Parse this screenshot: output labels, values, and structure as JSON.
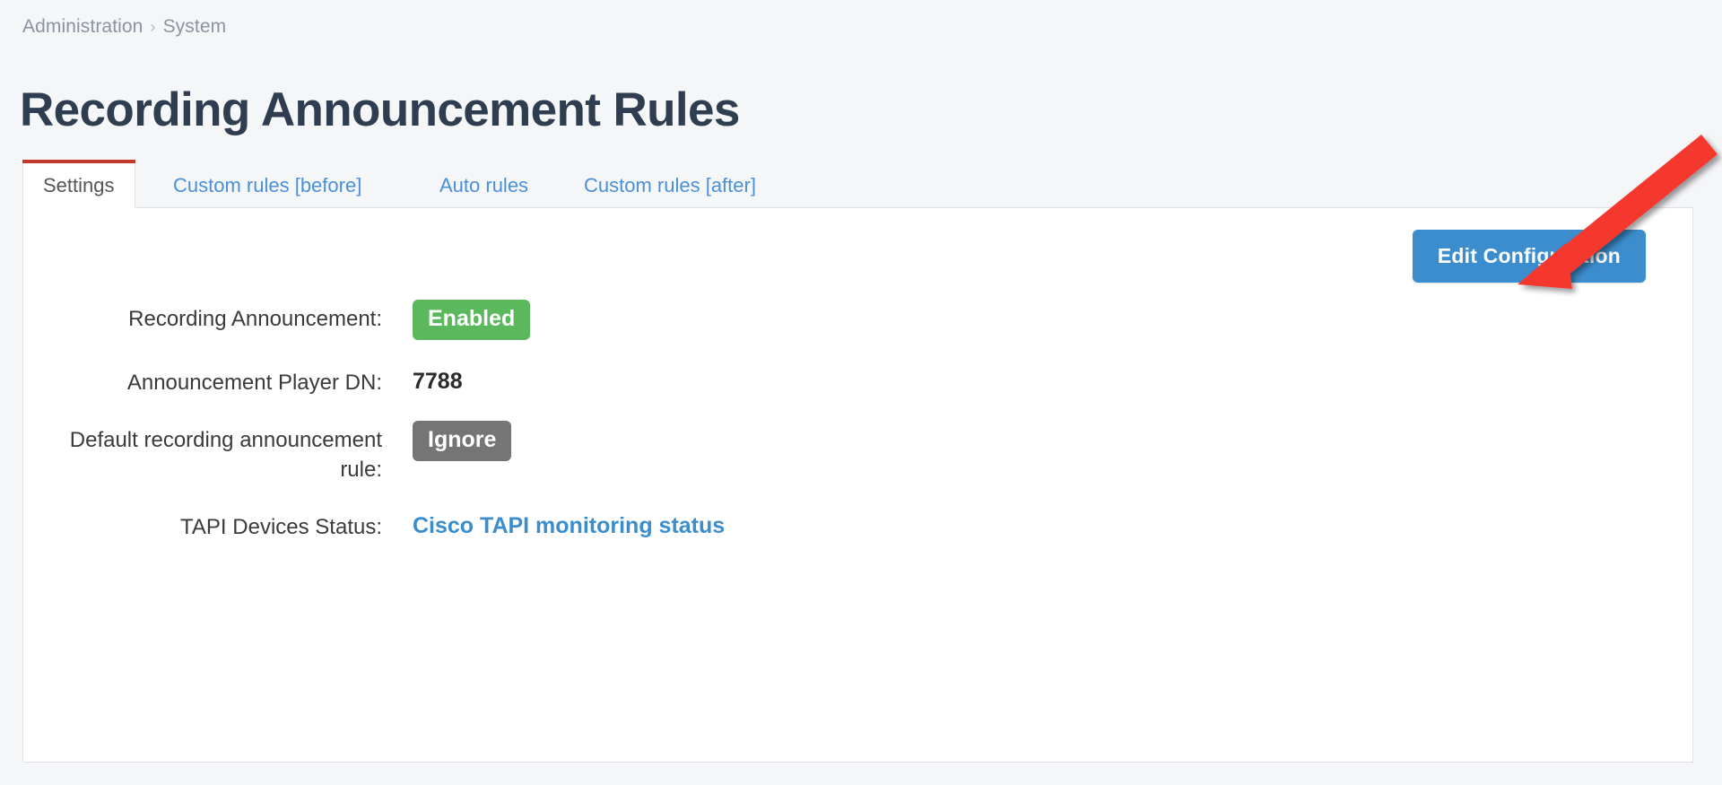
{
  "breadcrumb": {
    "items": [
      "Administration",
      "System"
    ],
    "separator": "›"
  },
  "page": {
    "title": "Recording Announcement Rules"
  },
  "tabs": [
    {
      "label": "Settings",
      "active": true
    },
    {
      "label": "Custom rules [before]",
      "active": false
    },
    {
      "label": "Auto rules",
      "active": false
    },
    {
      "label": "Custom rules [after]",
      "active": false
    }
  ],
  "toolbar": {
    "edit_configuration_label": "Edit Configuration"
  },
  "settings": {
    "rows": [
      {
        "label": "Recording Announcement:",
        "value": "Enabled",
        "kind": "badge-green"
      },
      {
        "label": "Announcement Player DN:",
        "value": "7788",
        "kind": "text"
      },
      {
        "label": "Default recording announcement rule:",
        "value": "Ignore",
        "kind": "badge-grey"
      },
      {
        "label": "TAPI Devices Status:",
        "value": "Cisco TAPI monitoring status",
        "kind": "link"
      }
    ]
  },
  "annotation": {
    "type": "arrow",
    "color": "#f4392f",
    "points_to": "Edit Configuration"
  },
  "colors": {
    "page_background": "#f5f6f8",
    "panel_background": "#ffffff",
    "title": "#2e3e50",
    "breadcrumb": "#8a94a0",
    "tab_link": "#4a90d9",
    "tab_active_border": "#c0392b",
    "primary_button": "#3c8dcd",
    "badge_enabled": "#5cb85c",
    "badge_ignore": "#757575",
    "link": "#3c8dcd",
    "border": "#dfe1e5"
  }
}
